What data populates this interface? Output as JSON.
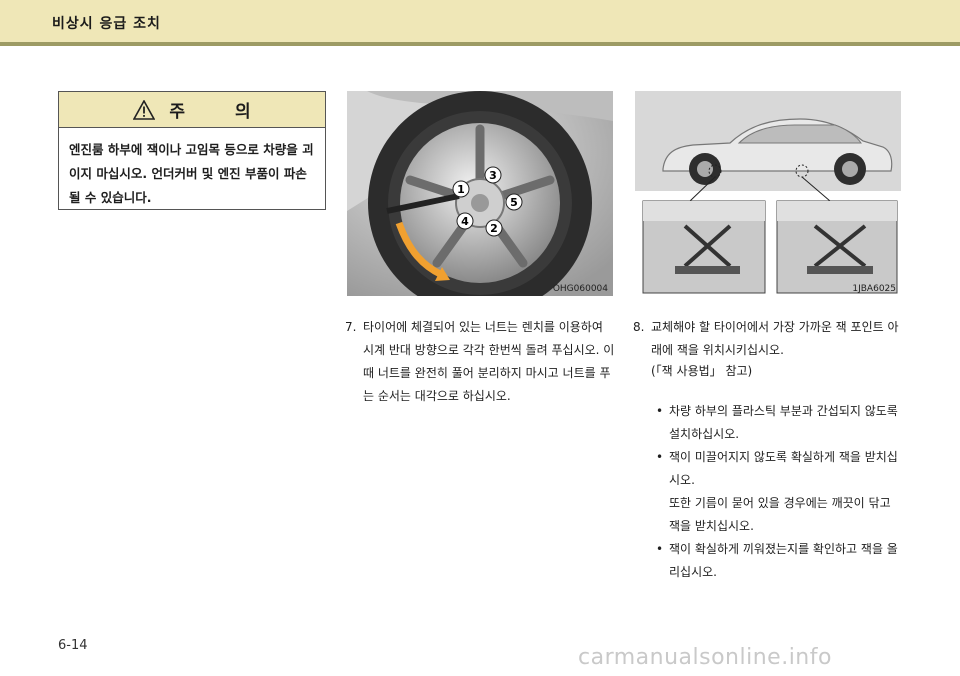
{
  "header": {
    "section_title": "비상시 응급 조치"
  },
  "caution": {
    "title": "주 의",
    "text": "엔진룸 하부에 잭이나 고임목 등으로 차량을 괴이지 마십시오. 언더커버 및 엔진 부품이 파손될 수 있습니다."
  },
  "figures": {
    "wheel": {
      "code": "OHG060004",
      "callouts": [
        "1",
        "2",
        "3",
        "4",
        "5"
      ]
    },
    "car": {
      "code": "1JBA6025"
    }
  },
  "step7": {
    "number": "7.",
    "text": "타이어에 체결되어 있는 너트는 렌치를 이용하여 시계 반대 방향으로 각각 한번씩 돌려 푸십시오. 이 때 너트를 완전히 풀어 분리하지 마시고 너트를 푸는 순서는 대각으로 하십시오."
  },
  "step8": {
    "number": "8.",
    "text": "교체해야 할 타이어에서 가장 가까운 잭 포인트 아래에 잭을 위치시키십시오.",
    "note": "(「잭 사용법」 참고)",
    "bullets": [
      {
        "text": "차량 하부의 플라스틱 부분과 간섭되지 않도록 설치하십시오."
      },
      {
        "text": "잭이 미끌어지지 않도록 확실하게 잭을 받치십시오.",
        "sub": "또한 기름이 묻어 있을 경우에는 깨끗이 닦고 잭을 받치십시오."
      },
      {
        "text": "잭이 확실하게 끼워졌는지를 확인하고 잭을 올리십시오."
      }
    ]
  },
  "footer": {
    "page_number": "6-14",
    "watermark": "carmanualsonline.info"
  },
  "colors": {
    "header_band": "#efe7b7",
    "header_rule": "#9d9b64",
    "arrow": "#f0a030"
  }
}
